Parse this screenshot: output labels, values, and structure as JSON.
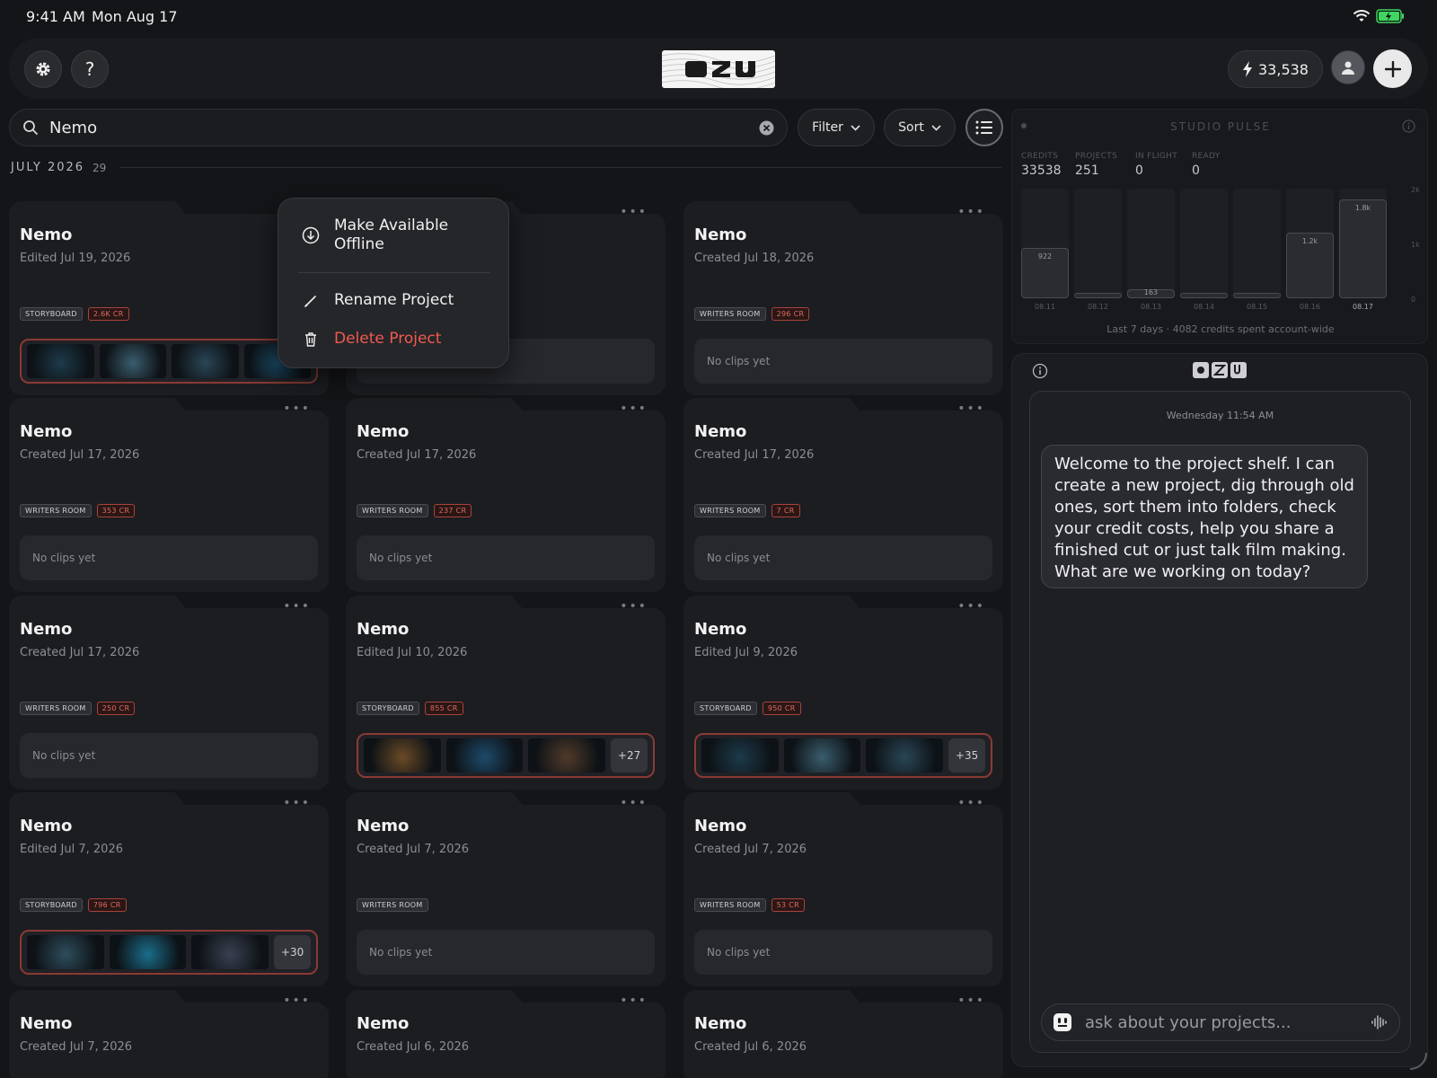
{
  "status": {
    "time": "9:41 AM",
    "date": "Mon Aug 17"
  },
  "header": {
    "credits": "33,538",
    "settings_icon": "gear-icon",
    "help_label": "?"
  },
  "search": {
    "value": "Nemo"
  },
  "toolbar": {
    "filter_label": "Filter",
    "sort_label": "Sort"
  },
  "section": {
    "label": "JULY 2026",
    "count": "29"
  },
  "context_menu": {
    "offline_line1": "Make Available",
    "offline_line2": "Offline",
    "rename": "Rename Project",
    "delete": "Delete Project"
  },
  "projects": [
    {
      "title": "Nemo",
      "date": "Edited Jul 19, 2026",
      "type": "STORYBOARD",
      "credits": "2.6K CR",
      "clips": null,
      "more": ""
    },
    {
      "title": "Nemo",
      "date": "",
      "type": "",
      "credits": "",
      "clips": null,
      "more": ""
    },
    {
      "title": "Nemo",
      "date": "Created Jul 18, 2026",
      "type": "WRITERS ROOM",
      "credits": "296 CR",
      "clips": "No clips yet",
      "more": ""
    },
    {
      "title": "Nemo",
      "date": "Created Jul 17, 2026",
      "type": "WRITERS ROOM",
      "credits": "353 CR",
      "clips": "No clips yet",
      "more": ""
    },
    {
      "title": "Nemo",
      "date": "Created Jul 17, 2026",
      "type": "WRITERS ROOM",
      "credits": "237 CR",
      "clips": "No clips yet",
      "more": ""
    },
    {
      "title": "Nemo",
      "date": "Created Jul 17, 2026",
      "type": "WRITERS ROOM",
      "credits": "7 CR",
      "clips": "No clips yet",
      "more": ""
    },
    {
      "title": "Nemo",
      "date": "Created Jul 17, 2026",
      "type": "WRITERS ROOM",
      "credits": "250 CR",
      "clips": "No clips yet",
      "more": ""
    },
    {
      "title": "Nemo",
      "date": "Edited Jul 10, 2026",
      "type": "STORYBOARD",
      "credits": "855 CR",
      "clips": null,
      "more": "+27"
    },
    {
      "title": "Nemo",
      "date": "Edited Jul 9, 2026",
      "type": "STORYBOARD",
      "credits": "950 CR",
      "clips": null,
      "more": "+35"
    },
    {
      "title": "Nemo",
      "date": "Edited Jul 7, 2026",
      "type": "STORYBOARD",
      "credits": "796 CR",
      "clips": null,
      "more": "+30"
    },
    {
      "title": "Nemo",
      "date": "Created Jul 7, 2026",
      "type": "WRITERS ROOM",
      "credits": "",
      "clips": "No clips yet",
      "more": ""
    },
    {
      "title": "Nemo",
      "date": "Created Jul 7, 2026",
      "type": "WRITERS ROOM",
      "credits": "53 CR",
      "clips": "No clips yet",
      "more": ""
    },
    {
      "title": "Nemo",
      "date": "Created Jul 7, 2026",
      "type": "",
      "credits": "",
      "clips": null,
      "more": ""
    },
    {
      "title": "Nemo",
      "date": "Created Jul 6, 2026",
      "type": "",
      "credits": "",
      "clips": null,
      "more": ""
    },
    {
      "title": "Nemo",
      "date": "Created Jul 6, 2026",
      "type": "",
      "credits": "",
      "clips": null,
      "more": ""
    }
  ],
  "pulse": {
    "title": "STUDIO PULSE",
    "stats": [
      {
        "label": "CREDITS",
        "value": "33538"
      },
      {
        "label": "PROJECTS",
        "value": "251"
      },
      {
        "label": "IN FLIGHT",
        "value": "0"
      },
      {
        "label": "READY",
        "value": "0"
      }
    ],
    "y_ticks": [
      "2k",
      "1k",
      "0"
    ],
    "footer": "Last 7 days · 4082 credits spent account-wide"
  },
  "chart_data": {
    "type": "bar",
    "categories": [
      "08.11",
      "08.12",
      "08.13",
      "08.14",
      "08.15",
      "08.16",
      "08.17"
    ],
    "values": [
      922,
      40,
      163,
      40,
      40,
      1200,
      1800
    ],
    "value_labels": [
      "922",
      "",
      "163",
      "",
      "",
      "1.2k",
      "1.8k"
    ],
    "ylim": [
      0,
      2000
    ],
    "y_tick_labels": [
      "2k",
      "1k",
      "0"
    ]
  },
  "chat": {
    "timestamp": "Wednesday 11:54 AM",
    "message": "Welcome to the project shelf. I can create a new project, dig through old ones, sort them into folders, check your credit costs, help you share a finished cut or just talk film making. What are we working on today?",
    "placeholder": "ask about your projects..."
  },
  "colors": {
    "accent_red": "#e06a5e",
    "danger": "#ef5a4e",
    "background": "#141518"
  }
}
